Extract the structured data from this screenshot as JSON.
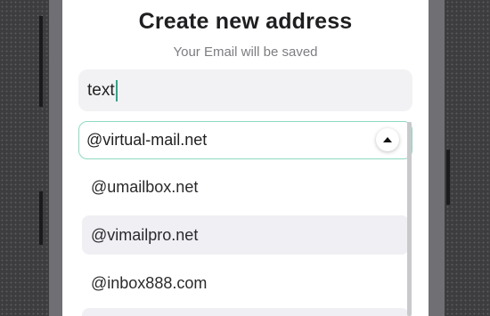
{
  "header": {
    "title": "Create new address",
    "subtitle": "Your Email will be saved"
  },
  "address_input": {
    "value": "text"
  },
  "domain_select": {
    "selected": "@virtual-mail.net",
    "toggle_icon": "chevron-up-icon"
  },
  "domain_options": [
    {
      "label": "@umailbox.net",
      "highlighted": false
    },
    {
      "label": "@vimailpro.net",
      "highlighted": true
    },
    {
      "label": "@inbox888.com",
      "highlighted": false
    }
  ],
  "colors": {
    "accent": "#8fd9c1",
    "caret": "#2aa889",
    "input_bg": "#f2f2f5",
    "text_primary": "#1f1f22",
    "text_secondary": "#7d7d82"
  }
}
